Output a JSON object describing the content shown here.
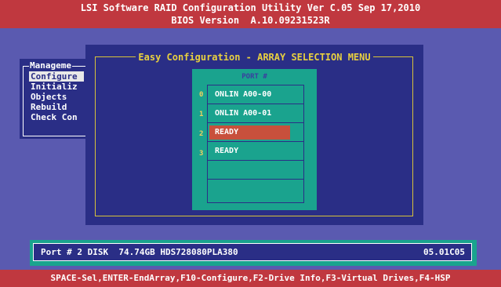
{
  "header": {
    "line1": "LSI Software RAID Configuration Utility Ver C.05 Sep 17,2010",
    "line2": "BIOS Version  A.10.09231523R"
  },
  "main_menu": {
    "title": "Manageme",
    "items": [
      {
        "label": "Configure",
        "selected": true
      },
      {
        "label": "Initializ",
        "selected": false
      },
      {
        "label": "Objects",
        "selected": false
      },
      {
        "label": "Rebuild",
        "selected": false
      },
      {
        "label": "Check Con",
        "selected": false
      }
    ]
  },
  "dialog": {
    "title": "Easy Configuration - ARRAY SELECTION MENU"
  },
  "array_panel": {
    "port_header": "PORT #",
    "slots": [
      {
        "index": "0",
        "label": "ONLIN A00-00",
        "selected": false
      },
      {
        "index": "1",
        "label": "ONLIN A00-01",
        "selected": false
      },
      {
        "index": "2",
        "label": "READY",
        "selected": true
      },
      {
        "index": "3",
        "label": "READY",
        "selected": false
      },
      {
        "index": "",
        "label": "",
        "selected": false
      },
      {
        "index": "",
        "label": "",
        "selected": false
      }
    ]
  },
  "status": {
    "port_info": "Port # 2 DISK  74.74GB HDS728080PLA380",
    "firmware": "05.01C05"
  },
  "helpbar": {
    "text": "SPACE-Sel,ENTER-EndArray,F10-Configure,F2-Drive Info,F3-Virtual Drives,F4-HSP"
  },
  "colors": {
    "background": "#5a5ab0",
    "header_bar": "#c0383f",
    "dialog": "#2a2e86",
    "panel": "#1aa38e",
    "highlight": "#c8503c",
    "title_text": "#e8d040"
  }
}
